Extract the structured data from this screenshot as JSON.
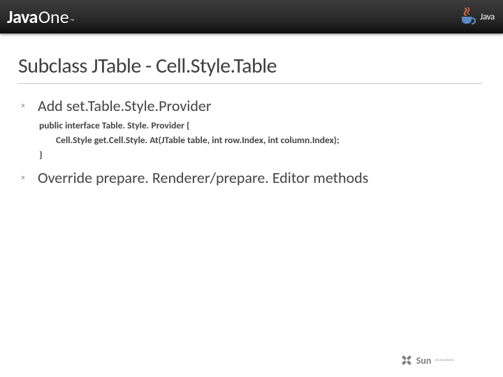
{
  "header": {
    "logo_left_java": "Java",
    "logo_left_one": "One",
    "logo_left_tm": "™",
    "logo_right_text": "Java"
  },
  "slide": {
    "title": "Subclass JTable - Cell.Style.Table",
    "bullets": [
      {
        "label": "Add set.Table.Style.Provider",
        "code_lines": [
          "public interface Table. Style. Provider {",
          "Cell.Style get.Cell.Style. At(JTable table, int row.Index, int column.Index);",
          "}"
        ]
      },
      {
        "label": "Override prepare. Renderer/prepare. Editor methods"
      }
    ]
  },
  "footer": {
    "brand": "Sun",
    "sub": "microsystems"
  }
}
